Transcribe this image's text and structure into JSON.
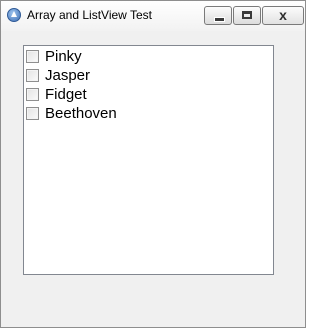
{
  "window": {
    "title": "Array and ListView Test",
    "controls": {
      "minimize": "minimize",
      "maximize": "maximize",
      "close": "x"
    }
  },
  "listview": {
    "items": [
      {
        "label": "Pinky",
        "checked": false
      },
      {
        "label": "Jasper",
        "checked": false
      },
      {
        "label": "Fidget",
        "checked": false
      },
      {
        "label": "Beethoven",
        "checked": false
      }
    ]
  }
}
